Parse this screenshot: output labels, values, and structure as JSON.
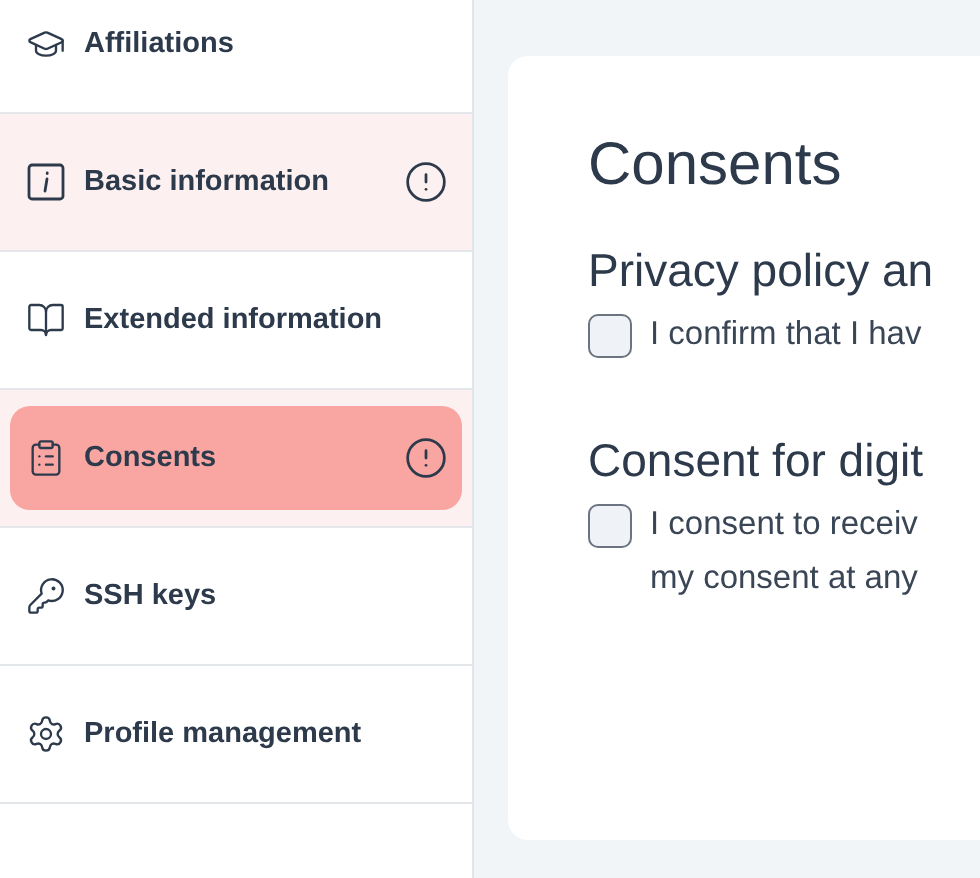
{
  "sidebar": {
    "items": [
      {
        "label": "Affiliations",
        "selected": false,
        "warning": false
      },
      {
        "label": "Basic information",
        "selected": false,
        "warning": true
      },
      {
        "label": "Extended information",
        "selected": false,
        "warning": false
      },
      {
        "label": "Consents",
        "selected": true,
        "warning": true
      },
      {
        "label": "SSH keys",
        "selected": false,
        "warning": false
      },
      {
        "label": "Profile management",
        "selected": false,
        "warning": false
      }
    ]
  },
  "content": {
    "title": "Consents",
    "sections": [
      {
        "title": "Privacy policy an",
        "checked": false,
        "lines": [
          "I confirm that I hav"
        ]
      },
      {
        "title": "Consent for digit",
        "checked": false,
        "lines": [
          "I consent to receiv",
          "my consent at any"
        ]
      }
    ]
  }
}
